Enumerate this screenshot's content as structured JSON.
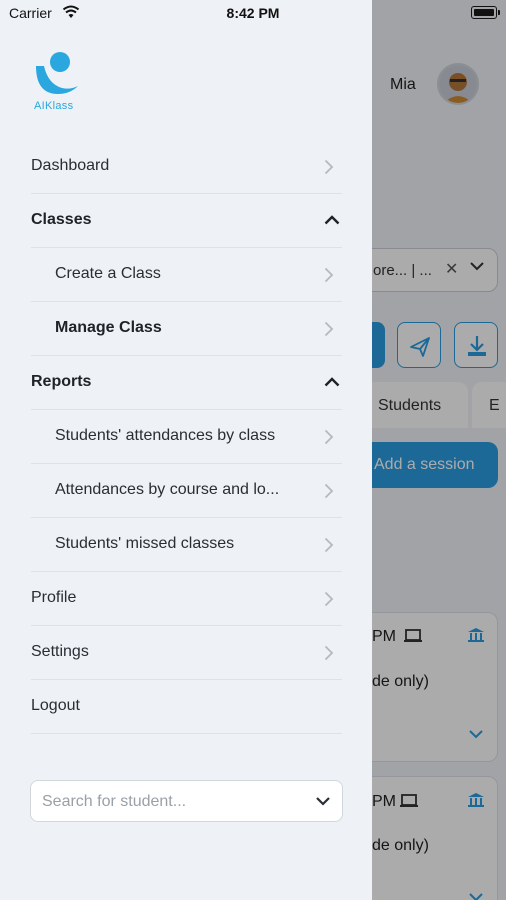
{
  "status_bar": {
    "carrier": "Carrier",
    "time": "8:42 PM"
  },
  "app": {
    "logo_text": "AIKlass",
    "brand_color": "#2aa7df"
  },
  "drawer": {
    "menu": [
      {
        "label": "Dashboard",
        "level": "top",
        "icon": "chevron-right-icon"
      },
      {
        "label": "Classes",
        "level": "top",
        "bold": true,
        "icon": "chevron-up-icon",
        "expanded": true
      },
      {
        "label": "Create a Class",
        "level": "sub",
        "icon": "chevron-right-icon"
      },
      {
        "label": "Manage Class",
        "level": "sub",
        "bold": true,
        "icon": "chevron-right-icon"
      },
      {
        "label": "Reports",
        "level": "top",
        "bold": true,
        "icon": "chevron-up-icon",
        "expanded": true
      },
      {
        "label": "Students' attendances by class",
        "level": "sub",
        "icon": "chevron-right-icon"
      },
      {
        "label": "Attendances by course and lo...",
        "level": "sub",
        "icon": "chevron-right-icon"
      },
      {
        "label": "Students' missed classes",
        "level": "sub",
        "icon": "chevron-right-icon"
      },
      {
        "label": "Profile",
        "level": "top",
        "icon": "chevron-right-icon"
      },
      {
        "label": "Settings",
        "level": "top",
        "icon": "chevron-right-icon"
      },
      {
        "label": "Logout",
        "level": "top",
        "icon": ""
      }
    ],
    "search": {
      "placeholder": "Search for student...",
      "value": ""
    }
  },
  "background": {
    "user_name": "Mia",
    "filter_text": "ore... | ...",
    "tabs": [
      "Students",
      "E"
    ],
    "add_session_label": "Add a session",
    "cards": [
      {
        "line1": "PM",
        "line2": "de only)"
      },
      {
        "line1": "PM",
        "line2": "de only)"
      }
    ],
    "accent_color": "#2b9be0"
  }
}
